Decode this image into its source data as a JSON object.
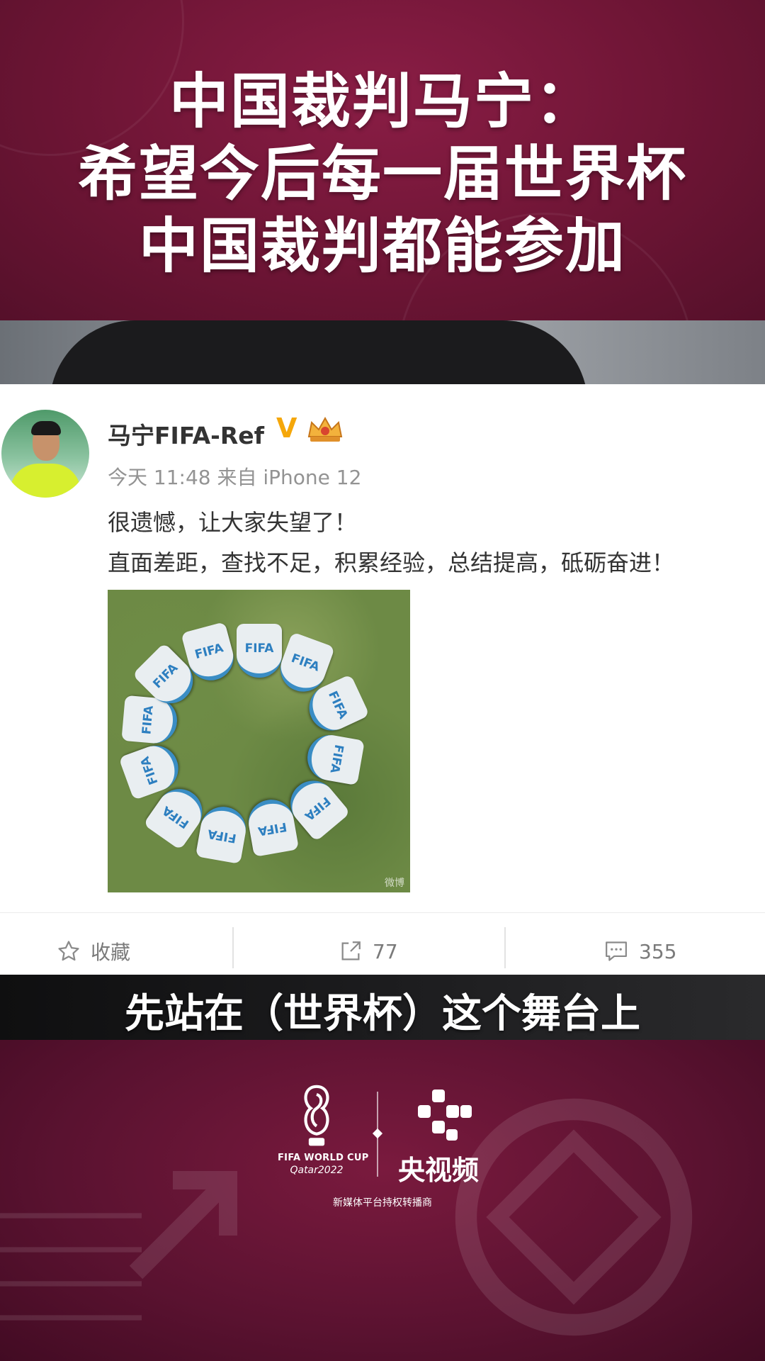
{
  "headline": {
    "line1": "中国裁判马宁：",
    "line2": "希望今后每一届世界杯",
    "line3": "中国裁判都能参加"
  },
  "post": {
    "username": "马宁FIFA-Ref",
    "verified_mark": "V",
    "meta": "今天 11:48 来自 iPhone 12",
    "line1": "很遗憾，让大家失望了！",
    "line2": "直面差距，查找不足，积累经验，总结提高，砥砺奋进！",
    "patch_label": "FIFA",
    "image_watermark": "微博"
  },
  "actions": {
    "favorite_label": "收藏",
    "share_count": "77",
    "comment_count": "355"
  },
  "subtitle": "先站在（世界杯）这个舞台上",
  "branding": {
    "worldcup_text": "FIFA WORLD CUP",
    "qatar_text": "Qatar2022",
    "broadcaster": "央视频",
    "rights_text": "新媒体平台持权转播商"
  },
  "colors": {
    "maroon": "#6e1535",
    "verified": "#f5a70a",
    "text_primary": "#333333",
    "text_meta": "#939393"
  }
}
